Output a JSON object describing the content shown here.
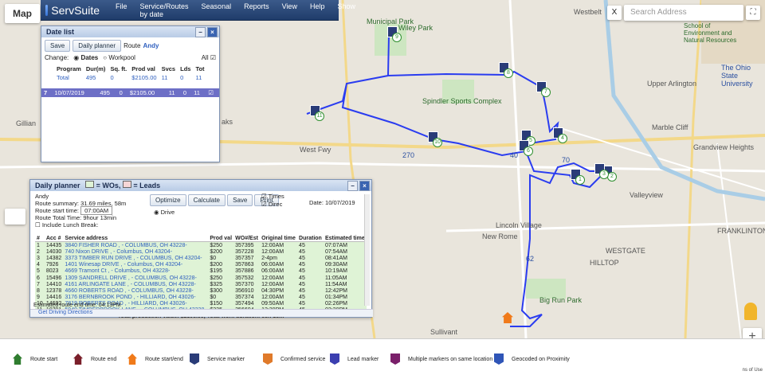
{
  "map": {
    "map_button": "Map",
    "search_placeholder": "Search Address",
    "close_label": "X",
    "fullscreen_icon": "fullscreen-icon",
    "zoom_in": "+",
    "zoom_out": "−",
    "credit": "ns of Use",
    "labels": {
      "gillian": "Gillian",
      "wiley_park": "Wiley Park",
      "spindler": "Spindler Sports Complex",
      "upper_arlington": "Upper Arlington",
      "marble_cliff": "Marble Cliff",
      "grandview": "Grandview Heights",
      "valleyview": "Valleyview",
      "lincoln_village": "Lincoln Village",
      "new_rome": "New Rome",
      "westgate": "WESTGATE",
      "hilltop": "HILLTOP",
      "franklinton": "FRANKLINTON",
      "big_run": "Big Run Park",
      "ohio_state": "The Ohio State University",
      "snr": "School of Environment and Natural Resources",
      "westbelt": "Westbelt",
      "sullivant": "Sullivant",
      "municipal": "Municipal Park",
      "aks": "aks",
      "west_fwy": "West Fwy",
      "road_270": "270",
      "road_70": "70",
      "road_40": "40",
      "road_62": "62"
    }
  },
  "app": {
    "brand": "ServSuite",
    "menu": [
      "File",
      "Service/Routes by date",
      "Seasonal",
      "Reports",
      "View",
      "Help",
      "Show"
    ]
  },
  "date_list": {
    "title": "Date list",
    "save": "Save",
    "daily_planner": "Daily planner",
    "route_label": "Route",
    "route_name": "Andy",
    "change_label": "Change:",
    "opt_dates": "Dates",
    "opt_workpool": "Workpool",
    "all_label": "All",
    "headers": [
      "Program",
      "Dur(m)",
      "Sq. ft.",
      "Prod val",
      "Svcs",
      "Lds",
      "Tot"
    ],
    "total_row": [
      "Total",
      "495",
      "0",
      "$2105.00",
      "11",
      "0",
      "11"
    ],
    "row": [
      "7",
      "10/07/2019",
      "495",
      "0",
      "$2105.00",
      "11",
      "0",
      "11"
    ]
  },
  "daily_planner": {
    "title": "Daily planner",
    "wos_legend": "= WOs,",
    "leads_legend": "= Leads",
    "route": "Andy",
    "summary_label": "Route summary:",
    "summary_value": "31.69 miles, 58m",
    "start_label": "Route start time:",
    "start_value": "07:00AM",
    "total_label": "Route Total Time:",
    "total_value": "9hour 13min",
    "lunch": "Include Lunch Break:",
    "optimize": "Optimize",
    "calculate": "Calculate",
    "save": "Save",
    "print": "Print",
    "times": "Times",
    "direc": "Direc",
    "drive": "Drive",
    "date_label": "Date:",
    "date_value": "10/07/2019",
    "headers": [
      "#",
      "Acc #",
      "Service address",
      "Prod val",
      "WO#/Est",
      "Original time",
      "Duration",
      "Estimated time"
    ],
    "rows": [
      [
        "1",
        "14435",
        "3840 FISHER ROAD , - COLUMBUS, OH 43228-",
        "$250",
        "357395",
        "12:00AM",
        "45",
        "07:07AM"
      ],
      [
        "2",
        "14030",
        "740 Nixon DRIVE , - Columbus, OH 43204-",
        "$200",
        "357228",
        "12:00AM",
        "45",
        "07:54AM"
      ],
      [
        "3",
        "14382",
        "3373 TIMBER RUN DRIVE , - COLUMBUS, OH 43204-",
        "$0",
        "357357",
        "2-4pm",
        "45",
        "08:41AM"
      ],
      [
        "4",
        "7926",
        "1401 Winesap DRIVE , - Columbus, OH 43204-",
        "$200",
        "357863",
        "06:00AM",
        "45",
        "09:30AM"
      ],
      [
        "5",
        "8023",
        "4669 Tramont Ct , - Columbus, OH 43228-",
        "$195",
        "357886",
        "06:00AM",
        "45",
        "10:19AM"
      ],
      [
        "6",
        "15496",
        "1309 SANDRELL DRIVE , - COLUMBUS, OH 43228-",
        "$250",
        "357532",
        "12:00AM",
        "45",
        "11:05AM"
      ],
      [
        "7",
        "14410",
        "4161 ARLINGATE LANE , - COLUMBUS, OH 43228-",
        "$325",
        "357370",
        "12:00AM",
        "45",
        "11:54AM"
      ],
      [
        "8",
        "12378",
        "4660 ROBERTS ROAD , - COLUMBUS, OH 43228-",
        "$300",
        "356910",
        "04:30PM",
        "45",
        "12:42PM"
      ],
      [
        "9",
        "14416",
        "3176 BERNBROOK POND , - HILLIARD, OH 43026-",
        "$0",
        "357374",
        "12:00AM",
        "45",
        "01:34PM"
      ],
      [
        "10",
        "14692",
        "7819 ROBERTS ROAD , - HILLIARD, OH 43026-",
        "$150",
        "357494",
        "09:50AM",
        "45",
        "02:26PM"
      ],
      [
        "11",
        "10791",
        "5949 TIMBERBROOK LANE , - COLUMBUS, OH 43228-",
        "$235",
        "356604",
        "12:30PM",
        "45",
        "03:20PM"
      ]
    ],
    "footer_total": "Total production value: $2105.00, Total work duration: 08h 15m",
    "est_end_label": "Estimated route end time:",
    "est_end_value": "04:13PM",
    "directions_link": "Get Driving Directions"
  },
  "markers": [
    "1",
    "2",
    "3",
    "4",
    "5",
    "6",
    "7",
    "8",
    "9",
    "10",
    "11"
  ],
  "legend": {
    "items": [
      {
        "label": "Route start",
        "icon": "route-start-icon",
        "color": "#2f7d2f"
      },
      {
        "label": "Route end",
        "icon": "route-end-icon",
        "color": "#7a1f2a"
      },
      {
        "label": "Route start/end",
        "icon": "route-start-end-icon",
        "color": "#f07a1a"
      },
      {
        "label": "Service marker",
        "icon": "service-marker-icon",
        "color": "#2a3c78"
      },
      {
        "label": "Confirmed service",
        "icon": "confirmed-service-icon",
        "color": "#e07a2a"
      },
      {
        "label": "Lead marker",
        "icon": "lead-marker-icon",
        "color": "#3b3fb0"
      },
      {
        "label": "Multiple markers on same location",
        "icon": "multiple-markers-icon",
        "color": "#7a1f6a"
      },
      {
        "label": "Geocoded on Proximity",
        "icon": "geocoded-proximity-icon",
        "color": "#2f55b7"
      }
    ]
  },
  "colors": {
    "route": "#2a3cf0",
    "header": "#1f3c6a",
    "selected_row": "#6d6fc6",
    "wo_row": "#dff3d6"
  }
}
